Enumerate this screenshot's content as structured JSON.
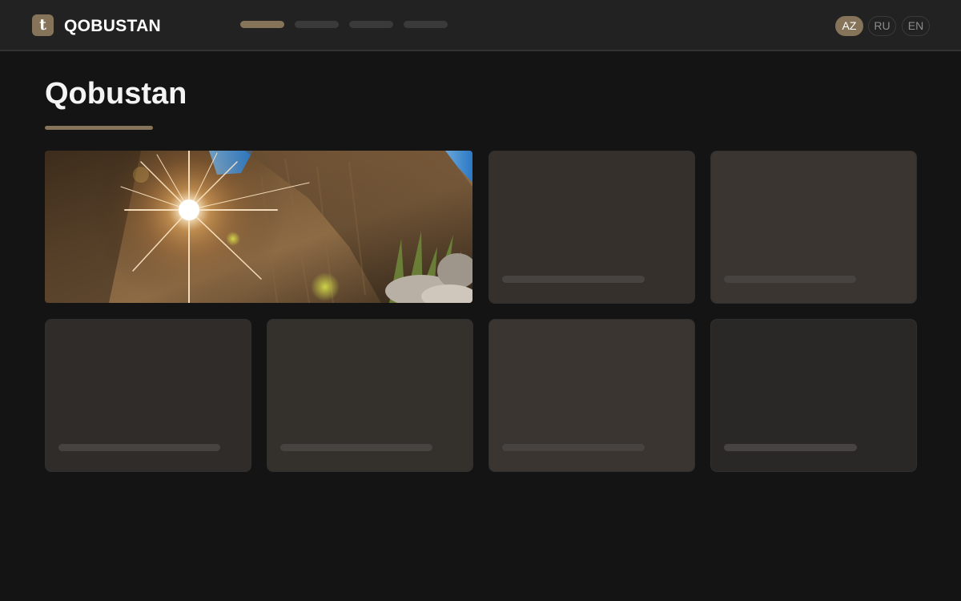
{
  "header": {
    "logo_letter": "t",
    "brand": "QOBUSTAN",
    "nav_placeholders": 4,
    "languages": [
      {
        "code": "AZ",
        "active": true
      },
      {
        "code": "RU",
        "active": false
      },
      {
        "code": "EN",
        "active": false
      }
    ]
  },
  "main": {
    "title": "Qobustan",
    "hero_image": "sunburst-over-petroglyph-rock",
    "cards_loading": 7
  },
  "colors": {
    "accent": "#857459",
    "background": "#141414",
    "topbar": "#222222",
    "skeleton_card": "#35302b",
    "skeleton_bar": "#474340"
  }
}
